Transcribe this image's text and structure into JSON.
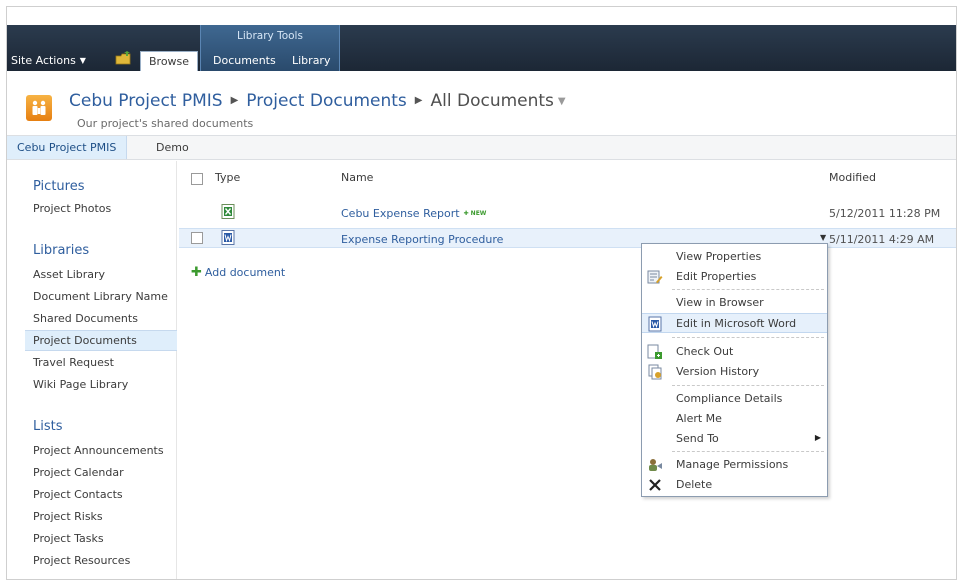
{
  "ribbon": {
    "site_actions": "Site Actions",
    "tabs": [
      "Browse",
      "Documents",
      "Library"
    ],
    "context_group": "Library Tools"
  },
  "title_area": {
    "breadcrumb": [
      "Cebu Project PMIS",
      "Project Documents",
      "All Documents"
    ],
    "subtitle": "Our project's shared documents"
  },
  "top_nav": [
    "Cebu Project PMIS",
    "Demo"
  ],
  "quick_launch": {
    "pictures_heading": "Pictures",
    "pictures": [
      "Project Photos"
    ],
    "libraries_heading": "Libraries",
    "libraries": [
      "Asset Library",
      "Document Library Name",
      "Shared Documents",
      "Project Documents",
      "Travel Request",
      "Wiki Page Library"
    ],
    "lists_heading": "Lists",
    "lists": [
      "Project Announcements",
      "Project Calendar",
      "Project Contacts",
      "Project Risks",
      "Project Tasks",
      "Project Resources"
    ]
  },
  "list": {
    "headers": {
      "type": "Type",
      "name": "Name",
      "modified": "Modified"
    },
    "rows": [
      {
        "name": "Cebu Expense Report",
        "badge": "NEW",
        "modified": "5/12/2011 11:28 PM",
        "icon": "excel-icon"
      },
      {
        "name": "Expense Reporting Procedure",
        "modified": "5/11/2011 4:29 AM",
        "icon": "word-icon"
      }
    ],
    "add_document": "Add document"
  },
  "context_menu": {
    "items": [
      "View Properties",
      "Edit Properties",
      "View in Browser",
      "Edit in Microsoft Word",
      "Check Out",
      "Version History",
      "Compliance Details",
      "Alert Me",
      "Send To",
      "Manage Permissions",
      "Delete"
    ]
  },
  "colors": {
    "ribbon_bg": "#1c2735",
    "context_tab": "#3f6891",
    "link": "#2f5e9e",
    "selection": "#dfeefb"
  }
}
